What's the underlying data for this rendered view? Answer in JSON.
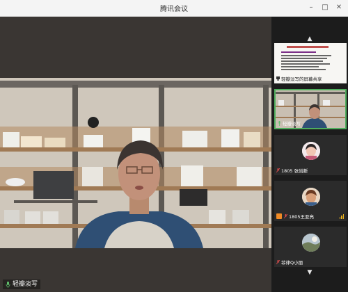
{
  "window": {
    "title": "腾讯会议",
    "controls": {
      "minimize": "–",
      "maximize": "□",
      "close": "✕"
    }
  },
  "main_video": {
    "speaker_label": "轻瓣淡写"
  },
  "sidebar": {
    "scroll_up": "▲",
    "scroll_down": "▼",
    "tiles": [
      {
        "label": "轻瓣淡写的屏幕共享",
        "kind": "screen-share"
      },
      {
        "label": "轻瓣淡写",
        "kind": "camera",
        "active": true
      },
      {
        "label": "1805 张尚断",
        "kind": "avatar"
      },
      {
        "label": "1805王亚亮",
        "kind": "avatar"
      },
      {
        "label": "菲律Q小丽",
        "kind": "avatar"
      }
    ]
  },
  "colors": {
    "active_border": "#4fae5d",
    "sidebar_bg": "#1c1c1c",
    "stage_bg": "#3a3633",
    "signal": "#e8b020"
  }
}
